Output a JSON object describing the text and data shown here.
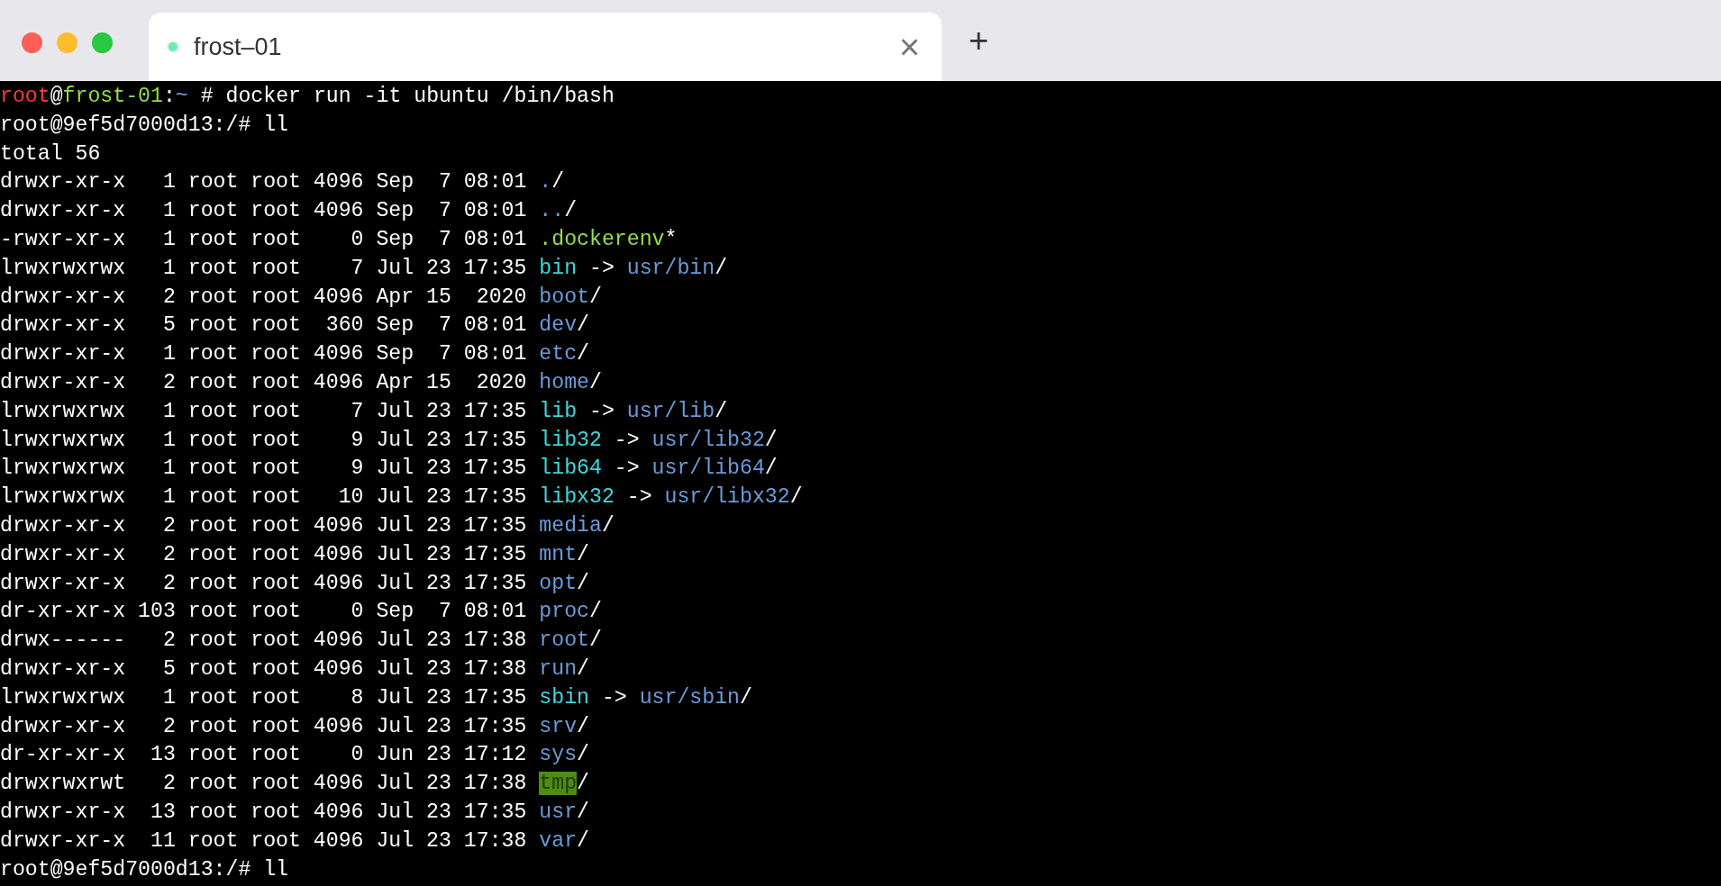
{
  "tabs": [
    {
      "title": "frost–01",
      "selected": true,
      "close": "×"
    }
  ],
  "new_tab": "+",
  "terminal": {
    "lines": [
      [
        {
          "text": "root",
          "kind": "user"
        },
        {
          "text": "@",
          "kind": "plain"
        },
        {
          "text": "frost-01",
          "kind": "host"
        },
        {
          "text": ":",
          "kind": "plain"
        },
        {
          "text": "~",
          "kind": "dir"
        },
        {
          "text": " # docker run -it ubuntu /bin/bash",
          "kind": "plain"
        }
      ],
      [
        {
          "text": "root@9ef5d7000d13:/# ll",
          "kind": "plain"
        }
      ],
      [
        {
          "text": "total 56",
          "kind": "plain"
        }
      ],
      [
        {
          "text": "drwxr-xr-x   1 root root 4096 Sep  7 08:01 ",
          "kind": "plain"
        },
        {
          "text": ".",
          "kind": "dir"
        },
        {
          "text": "/",
          "kind": "plain"
        }
      ],
      [
        {
          "text": "drwxr-xr-x   1 root root 4096 Sep  7 08:01 ",
          "kind": "plain"
        },
        {
          "text": "..",
          "kind": "dir"
        },
        {
          "text": "/",
          "kind": "plain"
        }
      ],
      [
        {
          "text": "-rwxr-xr-x   1 root root    0 Sep  7 08:01 ",
          "kind": "plain"
        },
        {
          "text": ".dockerenv",
          "kind": "exec"
        },
        {
          "text": "*",
          "kind": "plain"
        }
      ],
      [
        {
          "text": "lrwxrwxrwx   1 root root    7 Jul 23 17:35 ",
          "kind": "plain"
        },
        {
          "text": "bin",
          "kind": "link"
        },
        {
          "text": " -> ",
          "kind": "plain"
        },
        {
          "text": "usr/bin",
          "kind": "dir"
        },
        {
          "text": "/",
          "kind": "plain"
        }
      ],
      [
        {
          "text": "drwxr-xr-x   2 root root 4096 Apr 15  2020 ",
          "kind": "plain"
        },
        {
          "text": "boot",
          "kind": "dir"
        },
        {
          "text": "/",
          "kind": "plain"
        }
      ],
      [
        {
          "text": "drwxr-xr-x   5 root root  360 Sep  7 08:01 ",
          "kind": "plain"
        },
        {
          "text": "dev",
          "kind": "dir"
        },
        {
          "text": "/",
          "kind": "plain"
        }
      ],
      [
        {
          "text": "drwxr-xr-x   1 root root 4096 Sep  7 08:01 ",
          "kind": "plain"
        },
        {
          "text": "etc",
          "kind": "dir"
        },
        {
          "text": "/",
          "kind": "plain"
        }
      ],
      [
        {
          "text": "drwxr-xr-x   2 root root 4096 Apr 15  2020 ",
          "kind": "plain"
        },
        {
          "text": "home",
          "kind": "dir"
        },
        {
          "text": "/",
          "kind": "plain"
        }
      ],
      [
        {
          "text": "lrwxrwxrwx   1 root root    7 Jul 23 17:35 ",
          "kind": "plain"
        },
        {
          "text": "lib",
          "kind": "link"
        },
        {
          "text": " -> ",
          "kind": "plain"
        },
        {
          "text": "usr/lib",
          "kind": "dir"
        },
        {
          "text": "/",
          "kind": "plain"
        }
      ],
      [
        {
          "text": "lrwxrwxrwx   1 root root    9 Jul 23 17:35 ",
          "kind": "plain"
        },
        {
          "text": "lib32",
          "kind": "link"
        },
        {
          "text": " -> ",
          "kind": "plain"
        },
        {
          "text": "usr/lib32",
          "kind": "dir"
        },
        {
          "text": "/",
          "kind": "plain"
        }
      ],
      [
        {
          "text": "lrwxrwxrwx   1 root root    9 Jul 23 17:35 ",
          "kind": "plain"
        },
        {
          "text": "lib64",
          "kind": "link"
        },
        {
          "text": " -> ",
          "kind": "plain"
        },
        {
          "text": "usr/lib64",
          "kind": "dir"
        },
        {
          "text": "/",
          "kind": "plain"
        }
      ],
      [
        {
          "text": "lrwxrwxrwx   1 root root   10 Jul 23 17:35 ",
          "kind": "plain"
        },
        {
          "text": "libx32",
          "kind": "link"
        },
        {
          "text": " -> ",
          "kind": "plain"
        },
        {
          "text": "usr/libx32",
          "kind": "dir"
        },
        {
          "text": "/",
          "kind": "plain"
        }
      ],
      [
        {
          "text": "drwxr-xr-x   2 root root 4096 Jul 23 17:35 ",
          "kind": "plain"
        },
        {
          "text": "media",
          "kind": "dir"
        },
        {
          "text": "/",
          "kind": "plain"
        }
      ],
      [
        {
          "text": "drwxr-xr-x   2 root root 4096 Jul 23 17:35 ",
          "kind": "plain"
        },
        {
          "text": "mnt",
          "kind": "dir"
        },
        {
          "text": "/",
          "kind": "plain"
        }
      ],
      [
        {
          "text": "drwxr-xr-x   2 root root 4096 Jul 23 17:35 ",
          "kind": "plain"
        },
        {
          "text": "opt",
          "kind": "dir"
        },
        {
          "text": "/",
          "kind": "plain"
        }
      ],
      [
        {
          "text": "dr-xr-xr-x 103 root root    0 Sep  7 08:01 ",
          "kind": "plain"
        },
        {
          "text": "proc",
          "kind": "dir"
        },
        {
          "text": "/",
          "kind": "plain"
        }
      ],
      [
        {
          "text": "drwx------   2 root root 4096 Jul 23 17:38 ",
          "kind": "plain"
        },
        {
          "text": "root",
          "kind": "dir"
        },
        {
          "text": "/",
          "kind": "plain"
        }
      ],
      [
        {
          "text": "drwxr-xr-x   5 root root 4096 Jul 23 17:38 ",
          "kind": "plain"
        },
        {
          "text": "run",
          "kind": "dir"
        },
        {
          "text": "/",
          "kind": "plain"
        }
      ],
      [
        {
          "text": "lrwxrwxrwx   1 root root    8 Jul 23 17:35 ",
          "kind": "plain"
        },
        {
          "text": "sbin",
          "kind": "link"
        },
        {
          "text": " -> ",
          "kind": "plain"
        },
        {
          "text": "usr/sbin",
          "kind": "dir"
        },
        {
          "text": "/",
          "kind": "plain"
        }
      ],
      [
        {
          "text": "drwxr-xr-x   2 root root 4096 Jul 23 17:35 ",
          "kind": "plain"
        },
        {
          "text": "srv",
          "kind": "dir"
        },
        {
          "text": "/",
          "kind": "plain"
        }
      ],
      [
        {
          "text": "dr-xr-xr-x  13 root root    0 Jun 23 17:12 ",
          "kind": "plain"
        },
        {
          "text": "sys",
          "kind": "dir"
        },
        {
          "text": "/",
          "kind": "plain"
        }
      ],
      [
        {
          "text": "drwxrwxrwt   2 root root 4096 Jul 23 17:38 ",
          "kind": "plain"
        },
        {
          "text": "tmp",
          "kind": "sticky"
        },
        {
          "text": "/",
          "kind": "plain"
        }
      ],
      [
        {
          "text": "drwxr-xr-x  13 root root 4096 Jul 23 17:35 ",
          "kind": "plain"
        },
        {
          "text": "usr",
          "kind": "dir"
        },
        {
          "text": "/",
          "kind": "plain"
        }
      ],
      [
        {
          "text": "drwxr-xr-x  11 root root 4096 Jul 23 17:38 ",
          "kind": "plain"
        },
        {
          "text": "var",
          "kind": "dir"
        },
        {
          "text": "/",
          "kind": "plain"
        }
      ],
      [
        {
          "text": "root@9ef5d7000d13:/# ll",
          "kind": "plain"
        }
      ]
    ]
  }
}
